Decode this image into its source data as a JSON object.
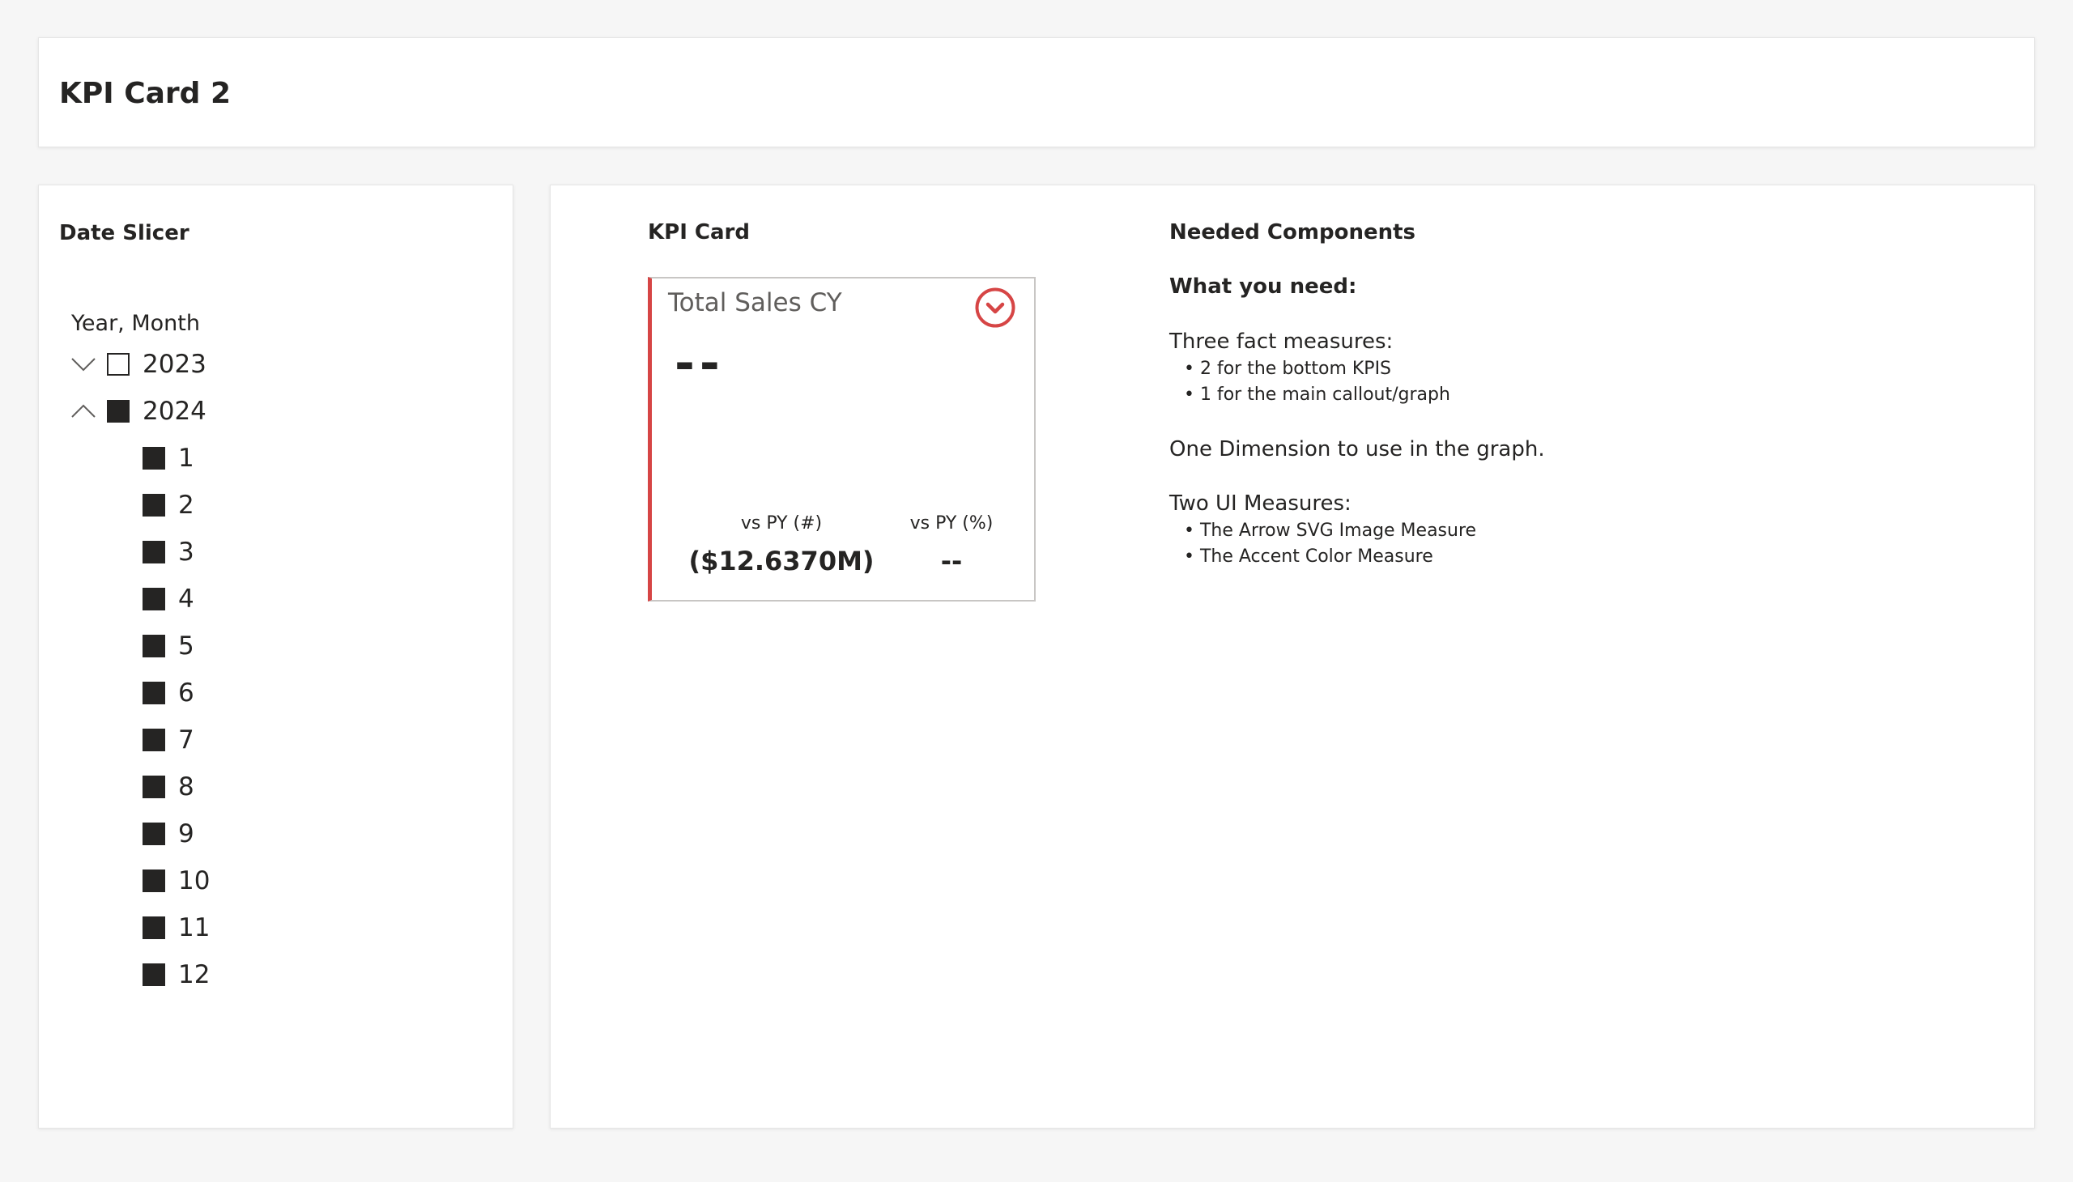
{
  "page": {
    "title": "KPI Card 2"
  },
  "slicer": {
    "section_title": "Date Slicer",
    "header": "Year, Month",
    "years": [
      {
        "label": "2023",
        "expanded": false,
        "checked": false
      },
      {
        "label": "2024",
        "expanded": true,
        "checked": true
      }
    ],
    "months": [
      "1",
      "2",
      "3",
      "4",
      "5",
      "6",
      "7",
      "8",
      "9",
      "10",
      "11",
      "12"
    ]
  },
  "kpi": {
    "section_title": "KPI Card",
    "card_title": "Total Sales CY",
    "main_value": "--",
    "arrow_icon": "chevron-down-circle-icon",
    "accent_color": "#d64545",
    "left_label": "vs PY (#)",
    "left_value": "($12.6370M)",
    "right_label": "vs PY (%)",
    "right_value": "--"
  },
  "components": {
    "section_title": "Needed Components",
    "subtitle": "What you need:",
    "fact_heading": "Three fact measures:",
    "fact_items": [
      "2 for the bottom KPIS",
      "1 for the main callout/graph"
    ],
    "dimension_line": "One Dimension to use in the graph.",
    "ui_heading": "Two UI Measures:",
    "ui_items": [
      "The Arrow SVG Image Measure",
      "The Accent Color Measure"
    ]
  }
}
